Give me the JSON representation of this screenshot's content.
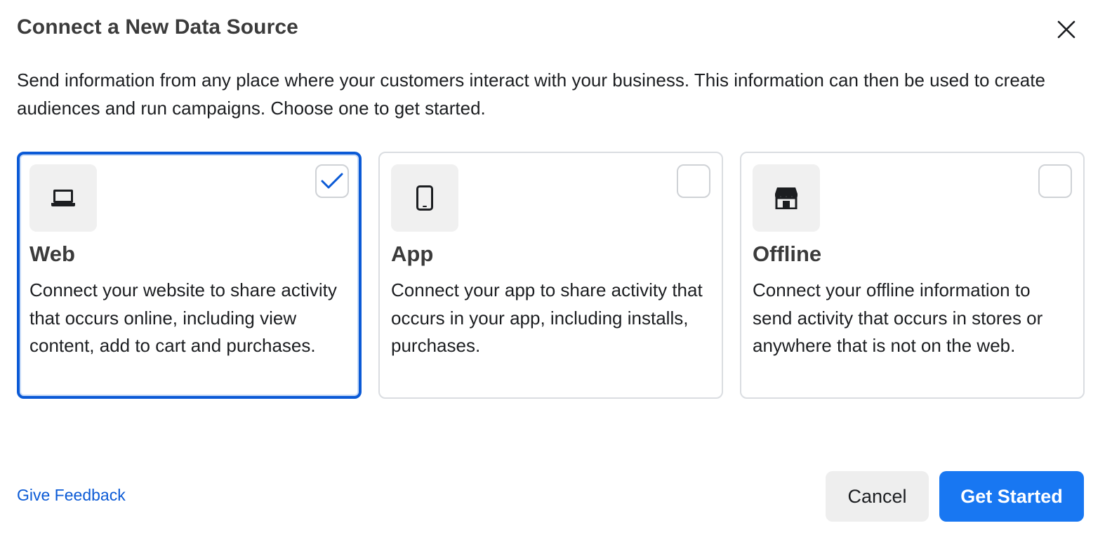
{
  "dialog": {
    "title": "Connect a New Data Source",
    "intro": "Send information from any place where your customers interact with your business. This information can then be used to create audiences and run campaigns. Choose one to get started."
  },
  "cards": [
    {
      "title": "Web",
      "description": "Connect your website to share activity that occurs online, including view content, add to cart and purchases.",
      "icon": "laptop-icon",
      "selected": true
    },
    {
      "title": "App",
      "description": "Connect your app to share activity that occurs in your app, including installs, purchases.",
      "icon": "mobile-phone-icon",
      "selected": false
    },
    {
      "title": "Offline",
      "description": "Connect your offline information to send activity that occurs in stores or anywhere that is not on the web.",
      "icon": "storefront-icon",
      "selected": false
    }
  ],
  "footer": {
    "feedback_label": "Give Feedback",
    "cancel_label": "Cancel",
    "primary_label": "Get Started"
  },
  "colors": {
    "accent": "#1877f2",
    "selected_border": "#0b5ad6",
    "link": "#0b5ad6"
  }
}
